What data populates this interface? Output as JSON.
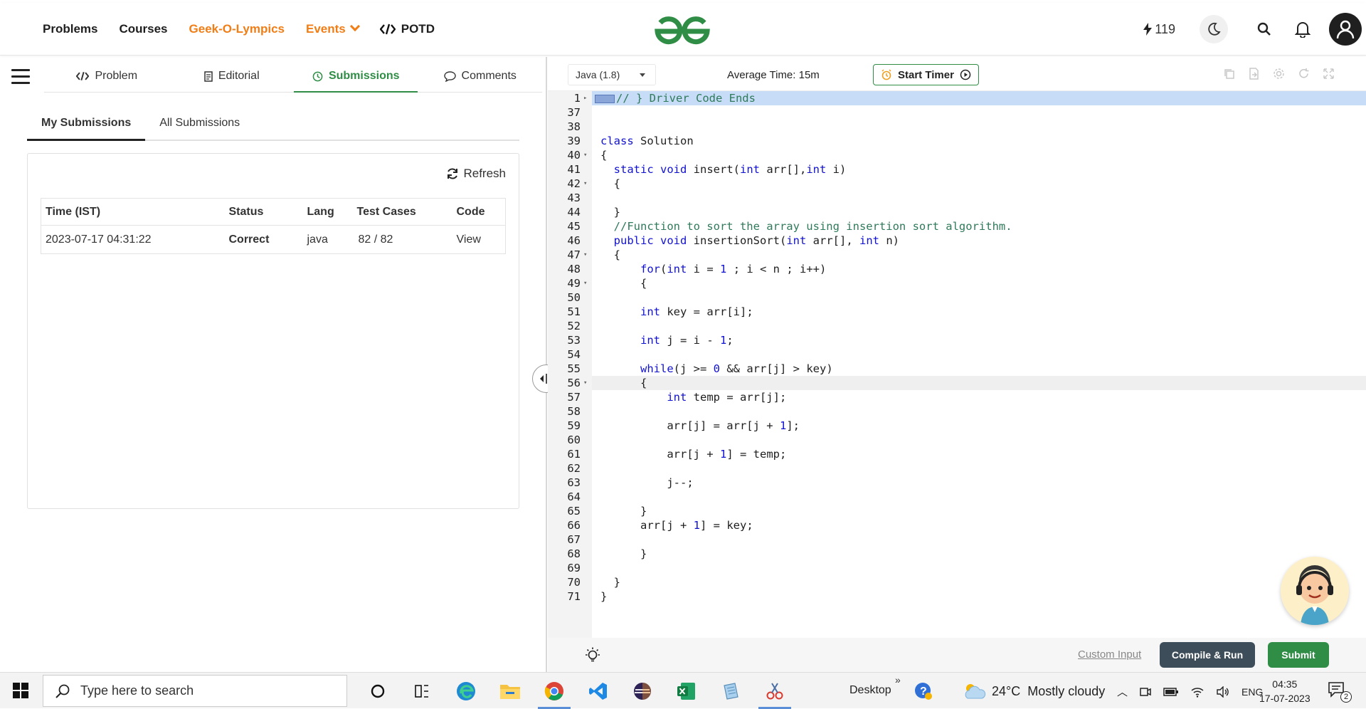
{
  "nav": {
    "links": [
      "Problems",
      "Courses",
      "Geek-O-Lympics",
      "Events",
      "POTD"
    ],
    "streak": "119"
  },
  "problem_tabs": [
    "Problem",
    "Editorial",
    "Submissions",
    "Comments"
  ],
  "submission_tabs": [
    "My Submissions",
    "All Submissions"
  ],
  "refresh_label": "Refresh",
  "table": {
    "headers": [
      "Time (IST)",
      "Status",
      "Lang",
      "Test Cases",
      "Code"
    ],
    "rows": [
      {
        "time": "2023-07-17 04:31:22",
        "status": "Correct",
        "lang": "java",
        "tests": "82 / 82",
        "code": "View"
      }
    ]
  },
  "editor": {
    "language": "Java (1.8)",
    "avg_time": "Average Time: 15m",
    "timer_label": "Start Timer",
    "custom_input": "Custom Input",
    "compile_label": "Compile & Run",
    "submit_label": "Submit",
    "lines": [
      {
        "n": "1",
        "fold": "right",
        "code": "// } Driver Code Ends"
      },
      {
        "n": "37",
        "code": ""
      },
      {
        "n": "38",
        "code": ""
      },
      {
        "n": "39",
        "code": "class Solution"
      },
      {
        "n": "40",
        "fold": "down",
        "code": "{"
      },
      {
        "n": "41",
        "code": "  static void insert(int arr[],int i)"
      },
      {
        "n": "42",
        "fold": "down",
        "code": "  {"
      },
      {
        "n": "43",
        "code": ""
      },
      {
        "n": "44",
        "code": "  }"
      },
      {
        "n": "45",
        "code": "  //Function to sort the array using insertion sort algorithm."
      },
      {
        "n": "46",
        "code": "  public void insertionSort(int arr[], int n)"
      },
      {
        "n": "47",
        "fold": "down",
        "code": "  {"
      },
      {
        "n": "48",
        "code": "      for(int i = 1 ; i < n ; i++)"
      },
      {
        "n": "49",
        "fold": "down",
        "code": "      {"
      },
      {
        "n": "50",
        "code": ""
      },
      {
        "n": "51",
        "code": "      int key = arr[i];"
      },
      {
        "n": "52",
        "code": ""
      },
      {
        "n": "53",
        "code": "      int j = i - 1;"
      },
      {
        "n": "54",
        "code": ""
      },
      {
        "n": "55",
        "code": "      while(j >= 0 && arr[j] > key)"
      },
      {
        "n": "56",
        "fold": "down",
        "code": "      {"
      },
      {
        "n": "57",
        "code": "          int temp = arr[j];"
      },
      {
        "n": "58",
        "code": ""
      },
      {
        "n": "59",
        "code": "          arr[j] = arr[j + 1];"
      },
      {
        "n": "60",
        "code": ""
      },
      {
        "n": "61",
        "code": "          arr[j + 1] = temp;"
      },
      {
        "n": "62",
        "code": ""
      },
      {
        "n": "63",
        "code": "          j--;"
      },
      {
        "n": "64",
        "code": ""
      },
      {
        "n": "65",
        "code": "      }"
      },
      {
        "n": "66",
        "code": "      arr[j + 1] = key;"
      },
      {
        "n": "67",
        "code": ""
      },
      {
        "n": "68",
        "code": "      }"
      },
      {
        "n": "69",
        "code": ""
      },
      {
        "n": "70",
        "code": "  }"
      },
      {
        "n": "71",
        "code": "}"
      }
    ],
    "current_line": "56"
  },
  "taskbar": {
    "search_placeholder": "Type here to search",
    "desktop_label": "Desktop",
    "weather": "24°C  Mostly cloudy",
    "lang": "ENG",
    "time": "04:35",
    "date": "17-07-2023",
    "notif_count": "2"
  },
  "colors": {
    "brand_green": "#2f8d46",
    "orange": "#f07d16",
    "link_blue": "#1a73c8"
  }
}
